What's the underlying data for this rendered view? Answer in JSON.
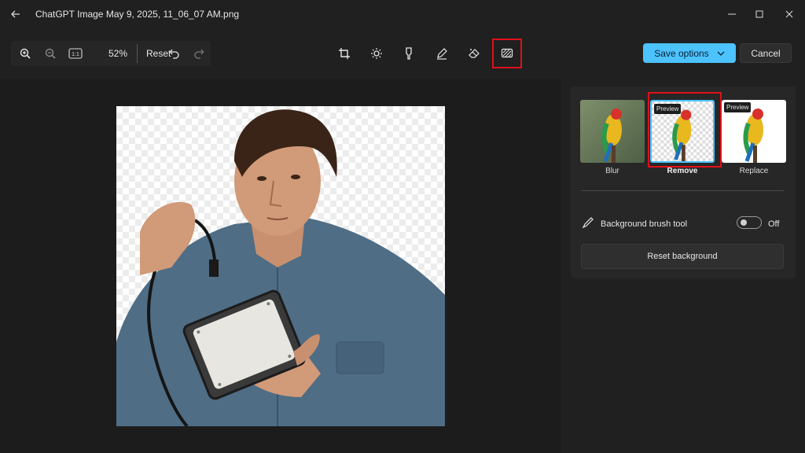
{
  "window": {
    "title": "ChatGPT Image May 9, 2025, 11_06_07 AM.png",
    "controls": [
      "minimize-icon",
      "maximize-icon",
      "close-icon"
    ]
  },
  "toolbar": {
    "zoom_in_icon": "zoom-in-icon",
    "zoom_out_icon": "zoom-out-icon",
    "actual_size_label": "1:1",
    "zoom_level": "52%",
    "reset_label": "Reset",
    "undo_icon": "undo-icon",
    "redo_icon": "redo-icon",
    "tools": [
      "crop-icon",
      "adjust-icon",
      "filter-icon",
      "markup-icon",
      "erase-icon",
      "background-icon"
    ],
    "active_tool": "background-icon",
    "save_label": "Save options",
    "cancel_label": "Cancel",
    "accent_color": "#4cc2ff",
    "highlight_color": "#e0101a"
  },
  "canvas": {
    "image_subject": "man holding hard drive"
  },
  "panel": {
    "options": [
      {
        "label": "Blur",
        "selected": false,
        "badge": ""
      },
      {
        "label": "Remove",
        "selected": true,
        "badge": "Preview"
      },
      {
        "label": "Replace",
        "selected": false,
        "badge": "Preview"
      }
    ],
    "brush_tool_label": "Background brush tool",
    "brush_tool_state": "Off",
    "reset_background_label": "Reset background"
  }
}
